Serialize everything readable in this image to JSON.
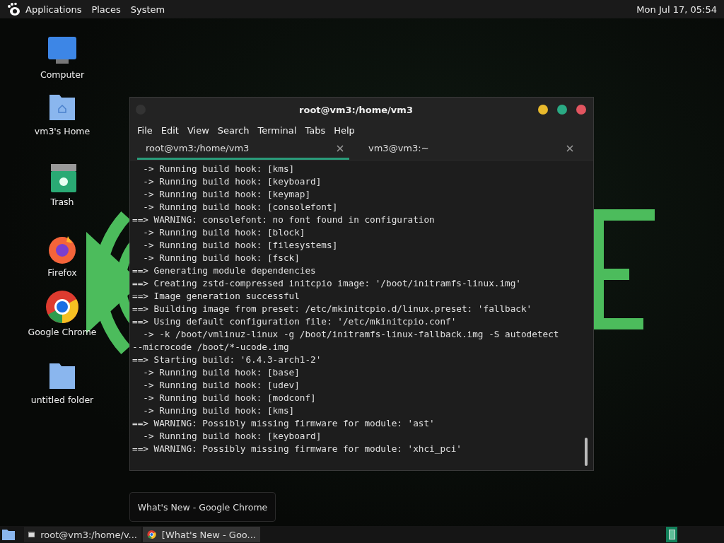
{
  "top_panel": {
    "menus": [
      "Applications",
      "Places",
      "System"
    ],
    "clock": "Mon Jul 17, 05:54"
  },
  "desktop_icons": [
    {
      "label": "Computer",
      "kind": "computer"
    },
    {
      "label": "vm3's Home",
      "kind": "home"
    },
    {
      "label": "Trash",
      "kind": "trash"
    },
    {
      "label": "Firefox",
      "kind": "firefox"
    },
    {
      "label": "Google Chrome",
      "kind": "chrome"
    },
    {
      "label": "untitled folder",
      "kind": "folder"
    }
  ],
  "terminal": {
    "title": "root@vm3:/home/vm3",
    "menu": [
      "File",
      "Edit",
      "View",
      "Search",
      "Terminal",
      "Tabs",
      "Help"
    ],
    "tabs": [
      {
        "label": "root@vm3:/home/vm3",
        "selected": true
      },
      {
        "label": "vm3@vm3:~",
        "selected": false
      }
    ],
    "lines": [
      "  -> Running build hook: [kms]",
      "  -> Running build hook: [keyboard]",
      "  -> Running build hook: [keymap]",
      "  -> Running build hook: [consolefont]",
      "==> WARNING: consolefont: no font found in configuration",
      "  -> Running build hook: [block]",
      "  -> Running build hook: [filesystems]",
      "  -> Running build hook: [fsck]",
      "==> Generating module dependencies",
      "==> Creating zstd-compressed initcpio image: '/boot/initramfs-linux.img'",
      "==> Image generation successful",
      "==> Building image from preset: /etc/mkinitcpio.d/linux.preset: 'fallback'",
      "==> Using default configuration file: '/etc/mkinitcpio.conf'",
      "  -> -k /boot/vmlinuz-linux -g /boot/initramfs-linux-fallback.img -S autodetect",
      "--microcode /boot/*-ucode.img",
      "==> Starting build: '6.4.3-arch1-2'",
      "  -> Running build hook: [base]",
      "  -> Running build hook: [udev]",
      "  -> Running build hook: [modconf]",
      "  -> Running build hook: [kms]",
      "==> WARNING: Possibly missing firmware for module: 'ast'",
      "  -> Running build hook: [keyboard]",
      "==> WARNING: Possibly missing firmware for module: 'xhci_pci'"
    ]
  },
  "tooltip": "What's New - Google Chrome",
  "taskbar": {
    "items": [
      {
        "label": "root@vm3:/home/v...",
        "kind": "terminal",
        "selected": false
      },
      {
        "label": "[What's New - Goo...",
        "kind": "chrome",
        "selected": true
      }
    ]
  }
}
